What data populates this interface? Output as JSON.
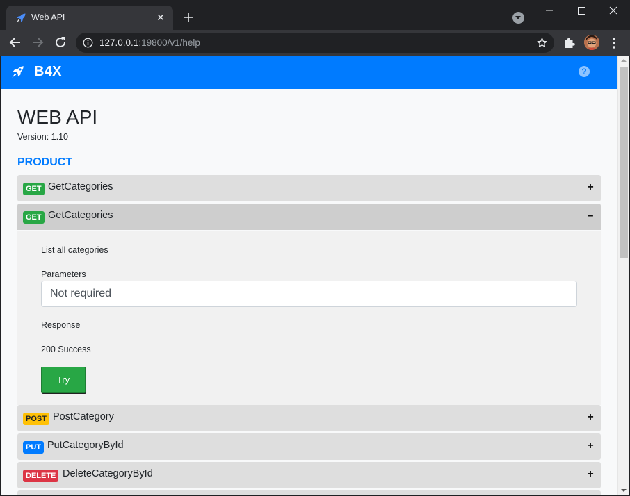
{
  "browser": {
    "tab_title": "Web API",
    "url_host": "127.0.0.1",
    "url_rest": ":19800/v1/help"
  },
  "app": {
    "brand": "B4X",
    "help_icon_glyph": "?"
  },
  "page": {
    "title": "WEB API",
    "version": "Version: 1.10",
    "section": "PRODUCT"
  },
  "endpoints": [
    {
      "method": "GET",
      "name": "GetCategories",
      "toggle": "+"
    },
    {
      "method": "GET",
      "name": "GetCategories",
      "toggle": "–"
    },
    {
      "method": "POST",
      "name": "PostCategory",
      "toggle": "+"
    },
    {
      "method": "PUT",
      "name": "PutCategoryById",
      "toggle": "+"
    },
    {
      "method": "DELETE",
      "name": "DeleteCategoryById",
      "toggle": "+"
    }
  ],
  "detail": {
    "description": "List all categories",
    "parameters_label": "Parameters",
    "parameters_value": "Not required",
    "response_label": "Response",
    "response_value": "200 Success",
    "try_label": "Try"
  },
  "colors": {
    "navbar": "#007bff",
    "get": "#28a745",
    "post": "#ffc107",
    "put": "#007bff",
    "delete": "#dc3545"
  }
}
